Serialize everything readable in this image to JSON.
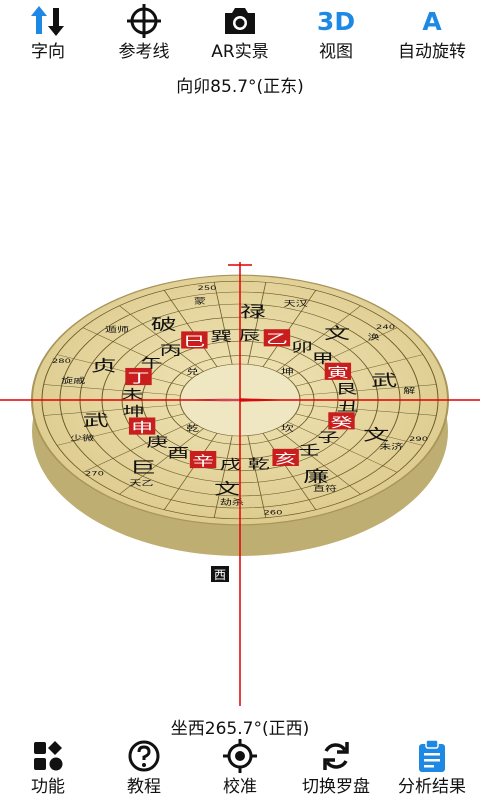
{
  "toolbar": {
    "items": [
      {
        "label": "字向",
        "icon": "sort-arrows-icon"
      },
      {
        "label": "参考线",
        "icon": "crosshair-icon"
      },
      {
        "label": "AR实景",
        "icon": "camera-icon"
      },
      {
        "label": "视图",
        "icon": "3d-view-icon",
        "glyph": "3D"
      },
      {
        "label": "自动旋转",
        "icon": "auto-rotate-icon",
        "glyph": "A"
      }
    ]
  },
  "reading": {
    "facing": "向卯85.7°(正东)",
    "sitting": "坐西265.7°(正西)"
  },
  "compass": {
    "ring_trigrams": [
      "乾",
      "兑",
      "坤",
      "坎"
    ],
    "ring_mountains": [
      "辛",
      "酉",
      "庚",
      "申",
      "坤",
      "未",
      "丁",
      "午",
      "丙",
      "巳",
      "巽",
      "辰",
      "乙",
      "卯",
      "甲",
      "寅",
      "艮",
      "丑",
      "癸",
      "子",
      "壬",
      "亥",
      "乾",
      "戌"
    ],
    "ring_stars": [
      "文",
      "巨",
      "武",
      "贞",
      "破",
      "禄",
      "文",
      "武",
      "文",
      "廉"
    ],
    "ring_small": [
      "直符",
      "劫杀",
      "天乙",
      "少微",
      "旋戚",
      "遁师",
      "蒙",
      "天汉",
      "涣",
      "解",
      "未济"
    ],
    "degree_labels": [
      "260",
      "270",
      "280",
      "250",
      "240",
      "290"
    ],
    "west_marker": "西",
    "colors": {
      "plate": "#e7d9a2",
      "plate_dark": "#c9b77b",
      "red": "#c81e1e",
      "line": "#e00000"
    }
  },
  "bottombar": {
    "items": [
      {
        "label": "功能",
        "icon": "grid-icon"
      },
      {
        "label": "教程",
        "icon": "help-icon"
      },
      {
        "label": "校准",
        "icon": "calibrate-icon"
      },
      {
        "label": "切换罗盘",
        "icon": "refresh-icon"
      },
      {
        "label": "分析结果",
        "icon": "clipboard-icon",
        "active": true
      }
    ]
  }
}
